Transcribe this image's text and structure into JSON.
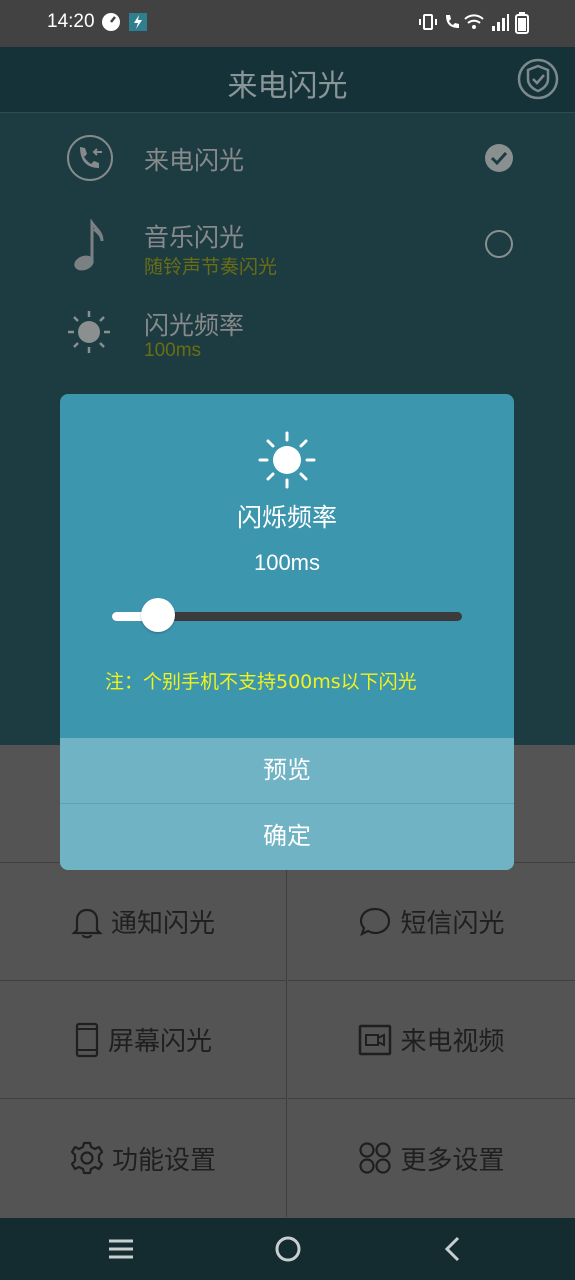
{
  "status_bar": {
    "time": "14:20"
  },
  "app": {
    "title": "来电闪光",
    "items": [
      {
        "title": "来电闪光",
        "subtitle": "",
        "checked": true
      },
      {
        "title": "音乐闪光",
        "subtitle": "随铃声节奏闪光",
        "checked": false
      },
      {
        "title": "闪光频率",
        "subtitle": "100ms"
      }
    ],
    "grid": [
      {
        "label": "通知闪光",
        "icon": "bell-icon"
      },
      {
        "label": "短信闪光",
        "icon": "chat-bubble-icon"
      },
      {
        "label": "屏幕闪光",
        "icon": "phone-device-icon"
      },
      {
        "label": "来电视频",
        "icon": "video-icon"
      },
      {
        "label": "功能设置",
        "icon": "gear-icon"
      },
      {
        "label": "更多设置",
        "icon": "four-circles-icon"
      }
    ]
  },
  "dialog": {
    "icon": "sun-icon",
    "title": "闪烁频率",
    "value": "100ms",
    "slider_fraction": 0.13,
    "note": "注：个别手机不支持500ms以下闪光",
    "preview_label": "预览",
    "confirm_label": "确定"
  },
  "colors": {
    "dialog_bg": "#3c96ad",
    "dialog_button_bg": "#6fb3c4",
    "note_text": "#f2f21c",
    "header_bg": "#143238"
  }
}
